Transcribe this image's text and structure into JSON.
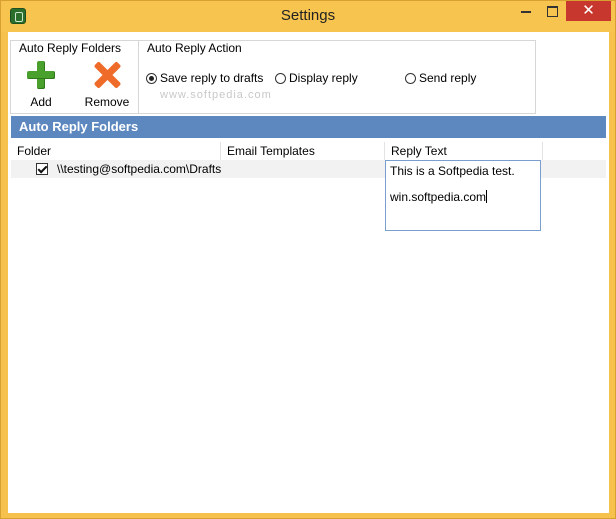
{
  "window": {
    "title": "Settings",
    "close_glyph": "✕"
  },
  "ribbon": {
    "folders_group_label": "Auto Reply Folders",
    "action_group_label": "Auto Reply Action",
    "add_label": "Add",
    "remove_label": "Remove",
    "actions": [
      {
        "label": "Save reply to drafts",
        "selected": true
      },
      {
        "label": "Display reply",
        "selected": false
      },
      {
        "label": "Send reply",
        "selected": false
      }
    ]
  },
  "panel": {
    "title": "Auto Reply Folders",
    "columns": [
      "Folder",
      "Email Templates",
      "Reply Text"
    ],
    "rows": [
      {
        "checked": true,
        "folder": "\\\\testing@softpedia.com\\Drafts",
        "email_template": "",
        "reply_text_line1": "This is a Softpedia test.",
        "reply_text_line2": "win.softpedia.com"
      }
    ]
  },
  "watermark": "www.softpedia.com",
  "icons": {
    "add": "plus-icon",
    "remove": "x-icon",
    "app": "app-icon"
  },
  "colors": {
    "window_frame": "#f6c14d",
    "close_button": "#c7372d",
    "panel_header": "#5d87bf",
    "add_icon": "#4aa02c",
    "remove_icon": "#ef6b2a"
  }
}
